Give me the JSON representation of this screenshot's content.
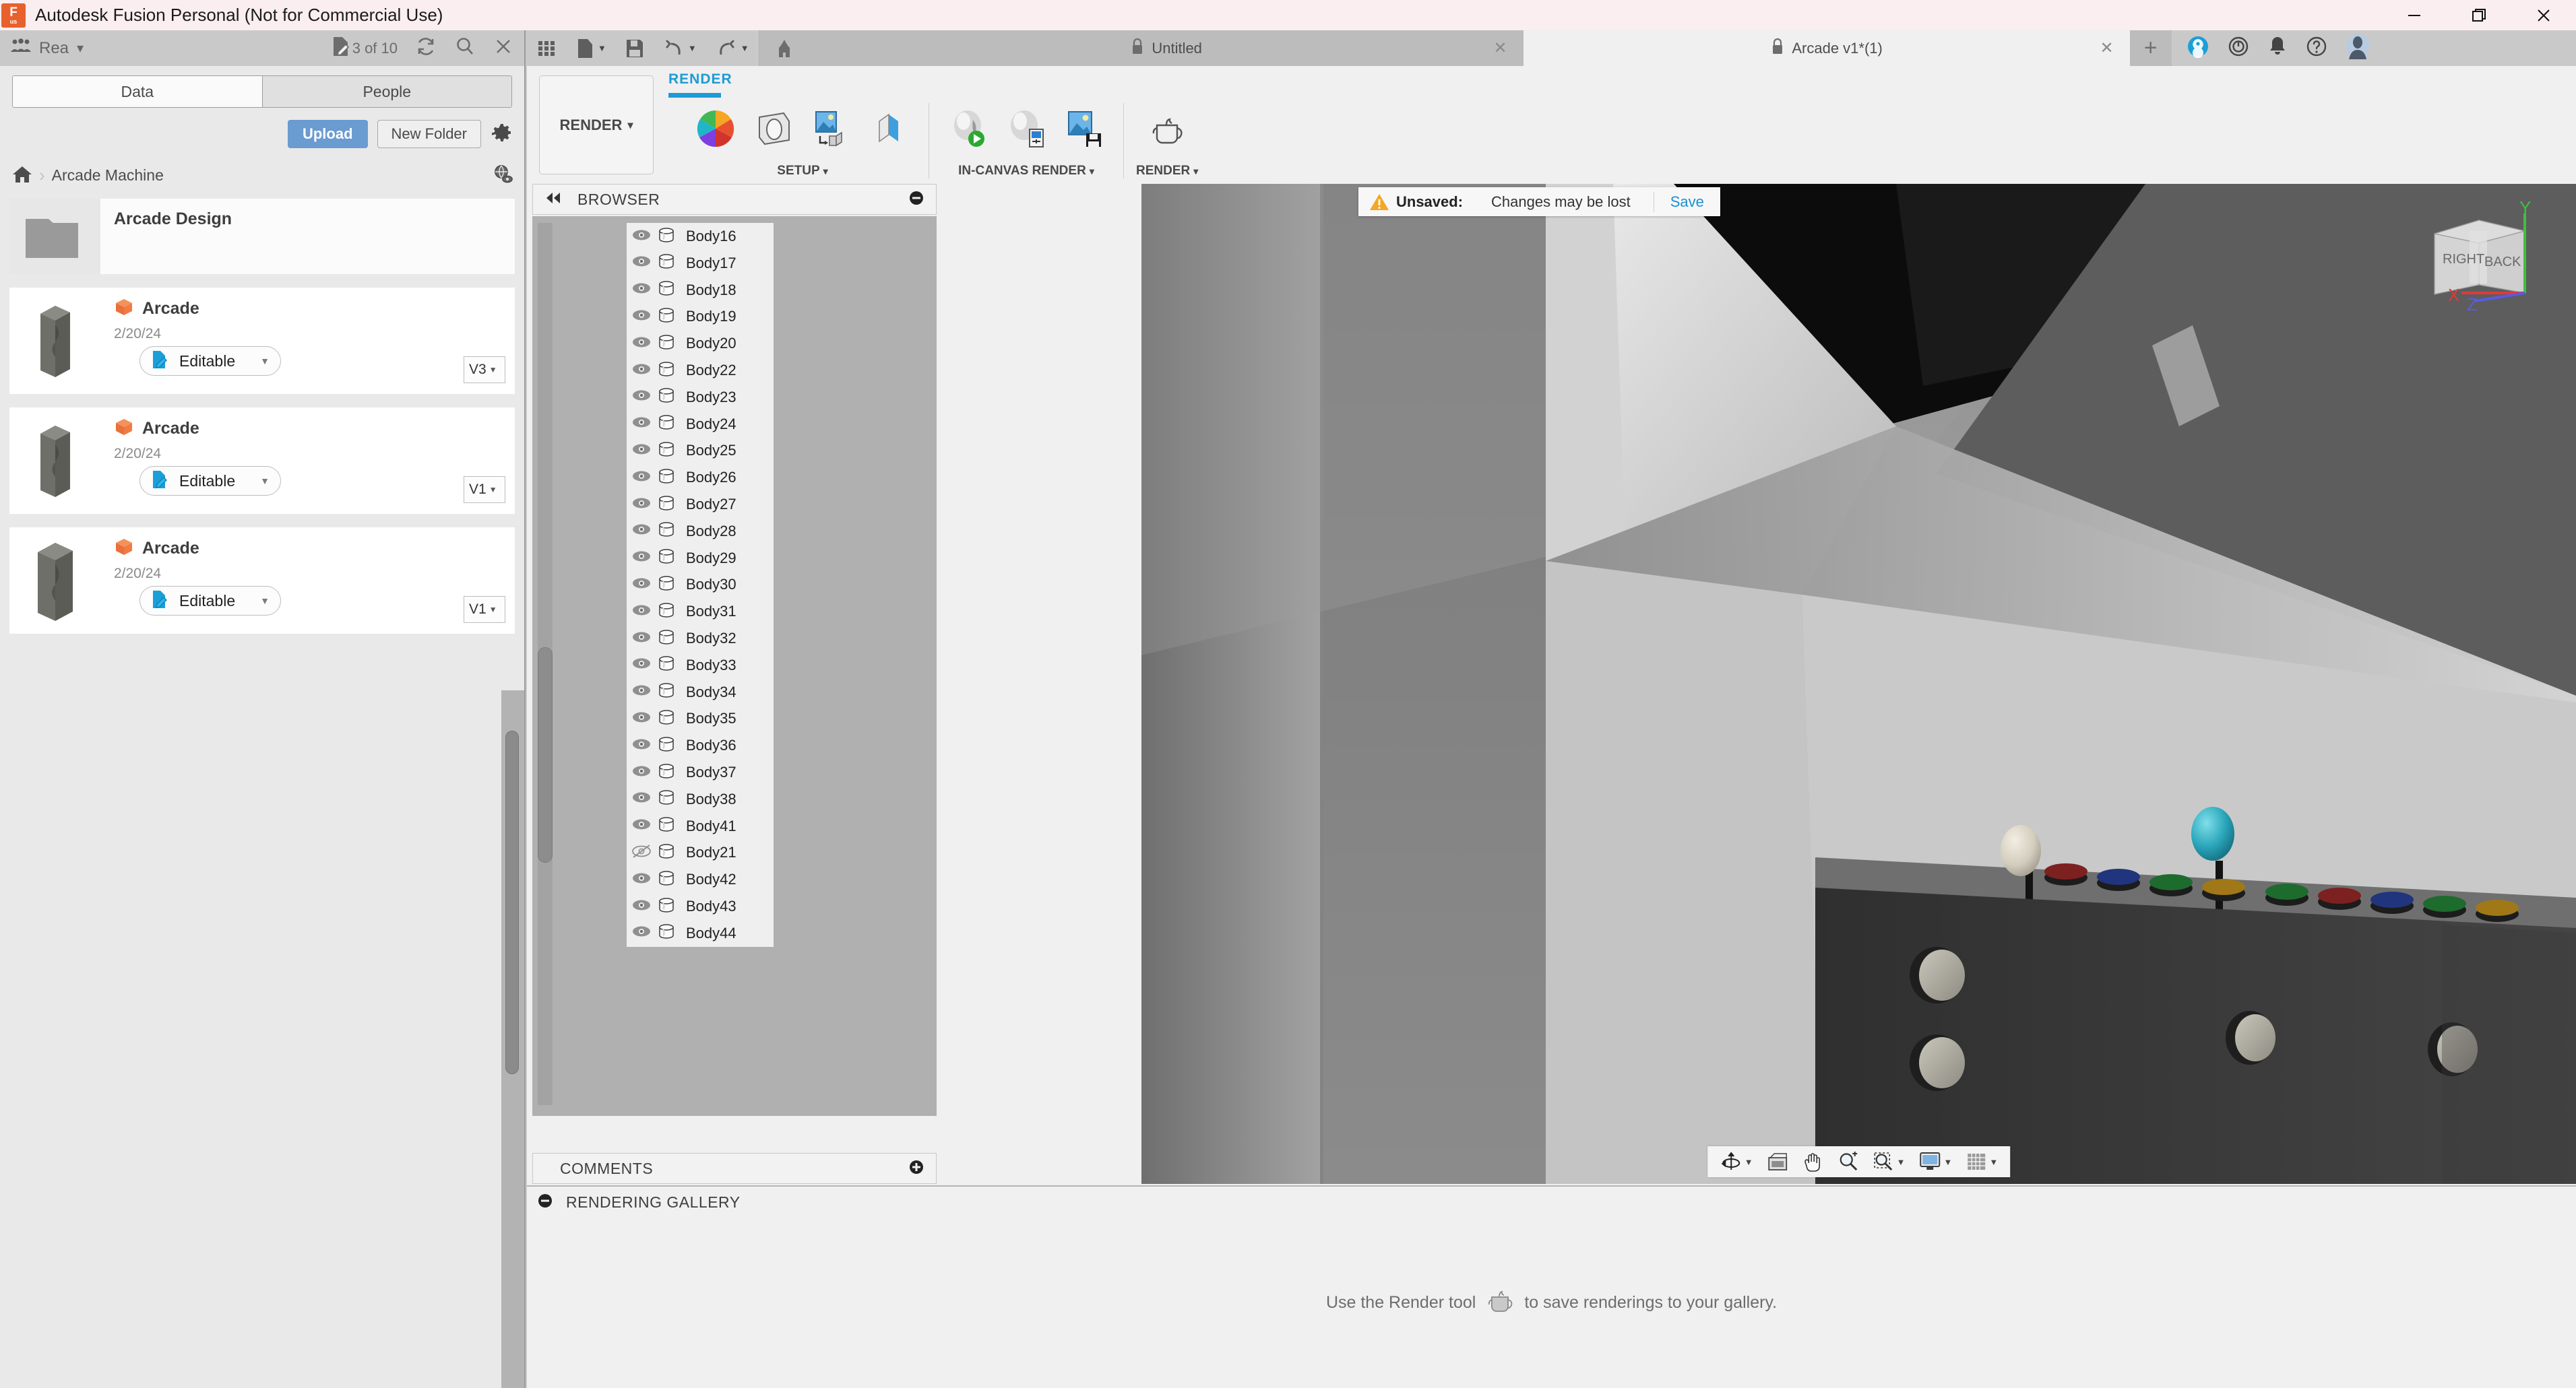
{
  "window": {
    "title": "Autodesk Fusion Personal (Not for Commercial Use)",
    "logo_line1": "F",
    "logo_line2": "us",
    "minimize": "—",
    "restore": "❐",
    "close": "✕"
  },
  "data_panel": {
    "team_name": "Rea",
    "team_caret": "▾",
    "edit_count": "3 of 10",
    "refresh_icon": "refresh-icon",
    "search_icon": "search-icon",
    "close_icon": "close-icon",
    "tabs": [
      {
        "label": "Data",
        "active": true
      },
      {
        "label": "People",
        "active": false
      }
    ],
    "upload_label": "Upload",
    "new_folder_label": "New Folder",
    "settings_icon": "gear-icon",
    "breadcrumb": {
      "home_icon": "home-icon",
      "separator": "›",
      "path": "Arcade Machine",
      "share_icon": "globe-eye-icon"
    },
    "folder": {
      "name": "Arcade Design"
    },
    "files": [
      {
        "name": "Arcade",
        "date": "2/20/24",
        "permission": "Editable",
        "version": "V3",
        "caret": "▾"
      },
      {
        "name": "Arcade",
        "date": "2/20/24",
        "permission": "Editable",
        "version": "V1",
        "caret": "▾"
      },
      {
        "name": "Arcade",
        "date": "2/20/24",
        "permission": "Editable",
        "version": "V1",
        "caret": "▾"
      }
    ]
  },
  "quick_access": {
    "grid_icon": "grid-menu-icon",
    "new_icon": "new-document-icon",
    "save_icon": "save-icon",
    "undo_icon": "undo-icon",
    "redo_icon": "redo-icon",
    "home_icon": "home-icon",
    "caret": "▾"
  },
  "document_tabs": [
    {
      "label": "Untitled",
      "active": false,
      "lock_icon": "lock-icon",
      "close": "✕"
    },
    {
      "label": "Arcade v1*(1)",
      "active": true,
      "lock_icon": "lock-icon",
      "close": "✕"
    }
  ],
  "tab_add": "+",
  "account_icons": {
    "extension_icon": "fusion-app-icon",
    "job_status_icon": "job-status-clock-icon",
    "notifications_icon": "bell-icon",
    "help_icon": "help-question-icon",
    "avatar_icon": "user-avatar"
  },
  "ribbon": {
    "workspace_label": "RENDER",
    "workspace_caret": "▾",
    "active_tab": "RENDER",
    "panels": [
      {
        "label": "SETUP",
        "caret": "▾",
        "tools": [
          {
            "name": "appearance-tool"
          },
          {
            "name": "scene-settings-tool"
          },
          {
            "name": "texture-map-controls-tool"
          },
          {
            "name": "decal-tool"
          }
        ]
      },
      {
        "label": "IN-CANVAS RENDER",
        "caret": "▾",
        "tools": [
          {
            "name": "in-canvas-render-tool"
          },
          {
            "name": "in-canvas-render-settings-tool"
          },
          {
            "name": "capture-image-tool"
          }
        ]
      },
      {
        "label": "RENDER",
        "caret": "▾",
        "tools": [
          {
            "name": "render-teapot-tool"
          }
        ]
      }
    ]
  },
  "browser": {
    "title": "BROWSER",
    "collapse_icon": "collapse-left-icon",
    "minus_icon": "−",
    "bodies": [
      {
        "label": "Body16",
        "visible": true
      },
      {
        "label": "Body17",
        "visible": true
      },
      {
        "label": "Body18",
        "visible": true
      },
      {
        "label": "Body19",
        "visible": true
      },
      {
        "label": "Body20",
        "visible": true
      },
      {
        "label": "Body22",
        "visible": true
      },
      {
        "label": "Body23",
        "visible": true
      },
      {
        "label": "Body24",
        "visible": true
      },
      {
        "label": "Body25",
        "visible": true
      },
      {
        "label": "Body26",
        "visible": true
      },
      {
        "label": "Body27",
        "visible": true
      },
      {
        "label": "Body28",
        "visible": true
      },
      {
        "label": "Body29",
        "visible": true
      },
      {
        "label": "Body30",
        "visible": true
      },
      {
        "label": "Body31",
        "visible": true
      },
      {
        "label": "Body32",
        "visible": true
      },
      {
        "label": "Body33",
        "visible": true
      },
      {
        "label": "Body34",
        "visible": true
      },
      {
        "label": "Body35",
        "visible": true
      },
      {
        "label": "Body36",
        "visible": true
      },
      {
        "label": "Body37",
        "visible": true
      },
      {
        "label": "Body38",
        "visible": true
      },
      {
        "label": "Body41",
        "visible": true
      },
      {
        "label": "Body21",
        "visible": false
      },
      {
        "label": "Body42",
        "visible": true
      },
      {
        "label": "Body43",
        "visible": true
      },
      {
        "label": "Body44",
        "visible": true
      }
    ]
  },
  "comments": {
    "title": "COMMENTS",
    "add_icon": "+"
  },
  "viewport": {
    "unsaved": {
      "warning_icon": "warning-triangle-icon",
      "label": "Unsaved:",
      "message": "Changes may be lost",
      "save_link": "Save"
    },
    "viewcube": {
      "face_left": "RIGHT",
      "face_right": "BACK",
      "axis_x": "X",
      "axis_y": "Y",
      "axis_z": "Z",
      "color_x": "#e03a3a",
      "color_y": "#3fc03f",
      "color_z": "#5a5ae0"
    },
    "navbar": [
      {
        "name": "orbit-tool",
        "caret": "▾"
      },
      {
        "name": "look-at-tool",
        "caret": ""
      },
      {
        "name": "pan-tool",
        "caret": ""
      },
      {
        "name": "zoom-tool",
        "caret": ""
      },
      {
        "name": "zoom-window-tool",
        "caret": "▾"
      },
      {
        "name": "display-settings-tool",
        "caret": "▾"
      },
      {
        "name": "grid-snaps-tool",
        "caret": "▾"
      }
    ],
    "scene_colors": {
      "background": "#9a9a9a",
      "cabinet_dark": "#3a3a3a",
      "joystick_teal": "#2ca3b8",
      "joystick_cream": "#d8d2c4"
    }
  },
  "rendering_gallery": {
    "title": "RENDERING GALLERY",
    "minus_icon": "−",
    "empty_message_before": "Use the Render tool",
    "empty_message_after": "to save renderings to your gallery.",
    "teapot_icon": "render-teapot-icon"
  }
}
